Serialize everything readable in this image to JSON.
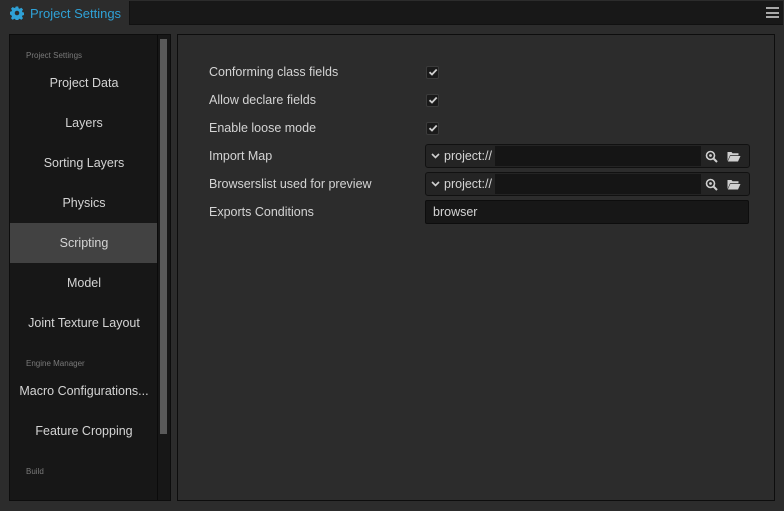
{
  "tab": {
    "title": "Project Settings",
    "icon": "gear-icon",
    "accent_color": "#2fa1d6"
  },
  "menu": {
    "icon": "hamburger-menu-icon"
  },
  "sidebar": {
    "sections": [
      {
        "label": "Project Settings",
        "items": [
          {
            "label": "Project Data",
            "active": false
          },
          {
            "label": "Layers",
            "active": false
          },
          {
            "label": "Sorting Layers",
            "active": false
          },
          {
            "label": "Physics",
            "active": false
          },
          {
            "label": "Scripting",
            "active": true
          },
          {
            "label": "Model",
            "active": false
          },
          {
            "label": "Joint Texture Layout",
            "active": false
          }
        ]
      },
      {
        "label": "Engine Manager",
        "items": [
          {
            "label": "Macro Configurations...",
            "active": false
          },
          {
            "label": "Feature Cropping",
            "active": false
          }
        ]
      },
      {
        "label": "Build",
        "items": []
      }
    ]
  },
  "scripting": {
    "conforming_class_fields": {
      "label": "Conforming class fields",
      "checked": true
    },
    "allow_declare_fields": {
      "label": "Allow declare fields",
      "checked": true
    },
    "enable_loose_mode": {
      "label": "Enable loose mode",
      "checked": true
    },
    "import_map": {
      "label": "Import Map",
      "protocol": "project://",
      "value": ""
    },
    "browserslist": {
      "label": "Browserslist used for preview",
      "protocol": "project://",
      "value": ""
    },
    "exports_conditions": {
      "label": "Exports Conditions",
      "value": "browser"
    }
  }
}
